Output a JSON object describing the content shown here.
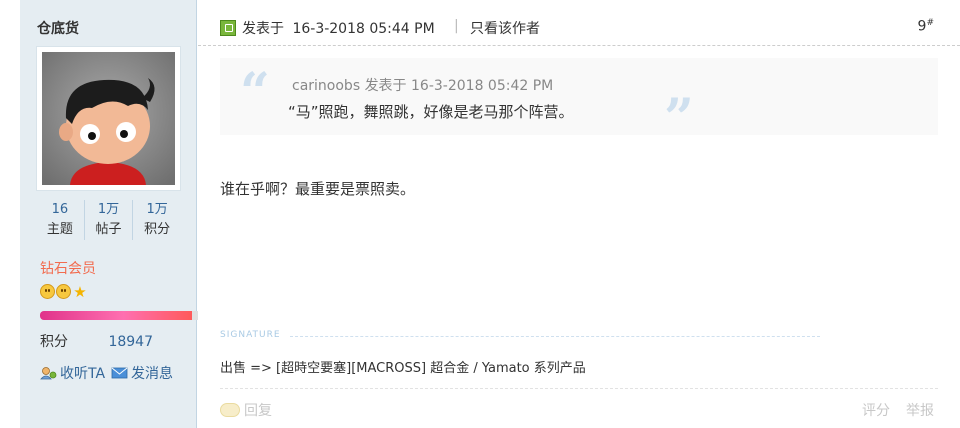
{
  "author": {
    "name": "仓底货",
    "stats": [
      {
        "value": "16",
        "label": "主题"
      },
      {
        "value": "1万",
        "label": "帖子"
      },
      {
        "value": "1万",
        "label": "积分"
      }
    ],
    "rank": "钻石会员",
    "level_progress": 0.92,
    "credit_label": "积分",
    "credit_value": "18947",
    "follow_label": "收听TA",
    "message_label": "发消息"
  },
  "post": {
    "posted_prefix": "发表于",
    "posted_time": "16-3-2018 05:44 PM",
    "only_author": "只看该作者",
    "floor": "9",
    "floor_suffix": "#",
    "quote": {
      "user": "carinoobs",
      "posted_prefix": "发表于",
      "time": "16-3-2018 05:42 PM",
      "text": "“马”照跑，舞照跳，好像是老马那个阵营。"
    },
    "message": "谁在乎啊？最重要是票照卖。",
    "signature_label": "SIGNATURE",
    "signature_text": "出售 => [超時空要塞][MACROSS] 超合金 / Yamato 系列产品",
    "reply_label": "回复",
    "rate_label": "评分",
    "report_label": "举报"
  },
  "colors": {
    "sidebar_bg": "#e5edf2",
    "link": "#336699",
    "rank": "#f26c4f",
    "quote_mark": "#cfe0ef"
  }
}
